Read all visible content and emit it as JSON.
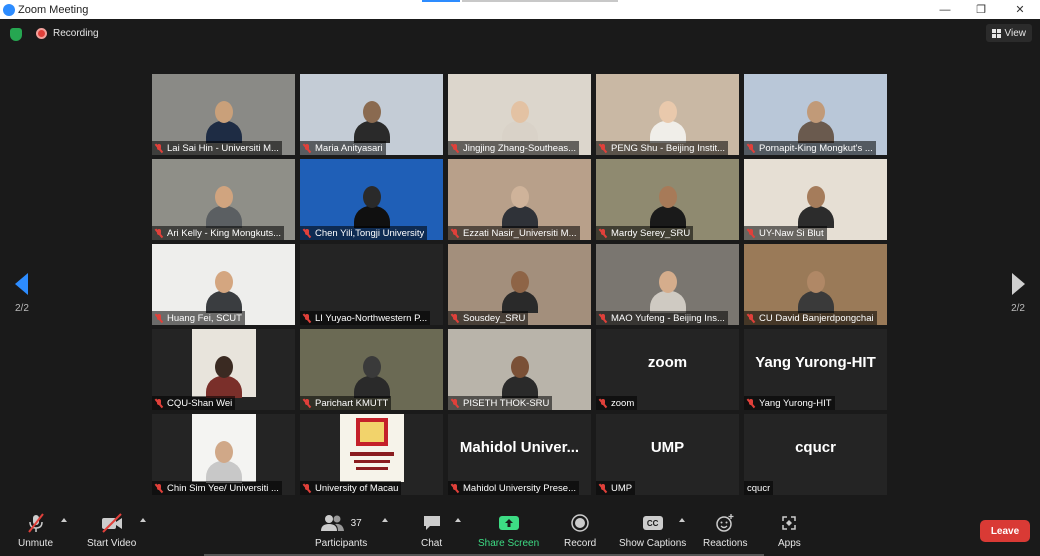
{
  "window": {
    "title": "Zoom Meeting"
  },
  "meeting_bar": {
    "recording_label": "Recording",
    "view_label": "View"
  },
  "pager": {
    "left": "2/2",
    "right": "2/2"
  },
  "tiles": [
    {
      "name": "Lai Sai Hin - Universiti M...",
      "bg": "#8a8a86",
      "head": "#c9a07a",
      "body": "#1e2c44"
    },
    {
      "name": "Maria Anityasari",
      "bg": "#c4ccd6",
      "head": "#8a6a50",
      "body": "#2a2a2a"
    },
    {
      "name": "Jingjing Zhang-Southeas...",
      "bg": "#dcd6cc",
      "head": "#e3c2a3",
      "body": "#d9d2c8"
    },
    {
      "name": "PENG Shu - Beijing Instit...",
      "bg": "#c9b8a4",
      "head": "#e9c9ac",
      "body": "#f0eee9"
    },
    {
      "name": "Pornapit-King Mongkut's ...",
      "bg": "#b9c7d8",
      "head": "#c19a78",
      "body": "#6a5a4e"
    },
    {
      "name": "Ari Kelly - King Mongkuts...",
      "bg": "#8f8f88",
      "head": "#d0a47f",
      "body": "#5b5f62"
    },
    {
      "name": "Chen Yili,Tongji University",
      "bg": "#1f5fb7",
      "head": "#2a2a2a",
      "body": "#101010"
    },
    {
      "name": "Ezzati Nasir_Universiti M...",
      "bg": "#b8a08a",
      "head": "#cfb39a",
      "body": "#2f3238"
    },
    {
      "name": "Mardy Serey_SRU",
      "bg": "#8f8a70",
      "head": "#a77a58",
      "body": "#1a1a1a"
    },
    {
      "name": "UY-Naw Si Blut",
      "bg": "#e6dfd4",
      "head": "#a57c5b",
      "body": "#2c2c2c"
    },
    {
      "name": "Huang Fei, SCUT",
      "bg": "#eeeeec",
      "head": "#d4a680",
      "body": "#3a3d40"
    },
    {
      "name": "LI Yuyao-Northwestern P...",
      "bg": "#242424",
      "head": "",
      "body": ""
    },
    {
      "name": "Sousdey_SRU",
      "bg": "#a38f7c",
      "head": "#8e6446",
      "body": "#2a2a2a"
    },
    {
      "name": "MAO Yufeng - Beijing Ins...",
      "bg": "#7a7670",
      "head": "#d5ad8c",
      "body": "#cfcac2"
    },
    {
      "name": "CU David Banjerdpongchai",
      "bg": "#9a7a58",
      "head": "#b08866",
      "body": "#3a3a3a"
    },
    {
      "name": "CQU-Shan Wei",
      "bg": "#242424",
      "head": "#3a2a22",
      "body": "#7a2f2a",
      "inset": "#e8e4dc"
    },
    {
      "name": "Parichart KMUTT",
      "bg": "#6b6a54",
      "head": "#3a3a3a",
      "body": "#2a2a2a"
    },
    {
      "name": "PISETH THOK-SRU",
      "bg": "#b9b4aa",
      "head": "#7a5036",
      "body": "#2a2a2a"
    },
    {
      "name": "zoom",
      "bg": "#242424",
      "bigname": "zoom"
    },
    {
      "name": "Yang Yurong-HIT",
      "bg": "#242424",
      "bigname": "Yang Yurong-HIT"
    },
    {
      "name": "Chin Sim Yee/ Universiti ...",
      "bg": "#242424",
      "head": "#d0a888",
      "body": "#c8c8c8",
      "inset": "#f4f4f2"
    },
    {
      "name": "University of Macau",
      "bg": "#242424",
      "inset": "#f6f3ea",
      "logo": true
    },
    {
      "name": "Mahidol University Prese...",
      "bg": "#242424",
      "bigname": "Mahidol  Univer..."
    },
    {
      "name": "UMP",
      "bg": "#242424",
      "bigname": "UMP"
    },
    {
      "name": "cqucr",
      "bg": "#242424",
      "bigname": "cqucr",
      "nomic": true
    }
  ],
  "toolbar": {
    "unmute": "Unmute",
    "start_video": "Start Video",
    "participants": "Participants",
    "participants_count": "37",
    "chat": "Chat",
    "share_screen": "Share Screen",
    "record": "Record",
    "show_captions": "Show Captions",
    "reactions": "Reactions",
    "apps": "Apps",
    "leave": "Leave",
    "cc_icon_text": "CC"
  },
  "colors": {
    "accent": "#2d8cff",
    "leave": "#d93a35",
    "share": "#3ddc84",
    "recording": "#e0403a"
  },
  "icons": [
    "zoom-app-icon",
    "shield-icon",
    "recording-dot-icon",
    "grid-icon",
    "arrow-left-icon",
    "arrow-right-icon",
    "muted-mic-icon",
    "video-off-icon",
    "participants-icon",
    "chat-icon",
    "share-screen-icon",
    "record-icon",
    "captions-icon",
    "reactions-icon",
    "apps-icon"
  ]
}
